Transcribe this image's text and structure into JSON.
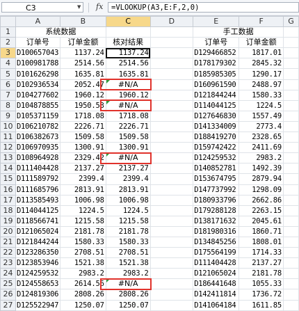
{
  "formula_bar": {
    "name_box": "C3",
    "fx_label": "fx",
    "formula": "=VLOOKUP(A3,E:F,2,0)"
  },
  "columns": [
    "A",
    "B",
    "C",
    "D",
    "E",
    "F",
    "G"
  ],
  "active_column": "C",
  "active_row": "3",
  "header_row1": {
    "left_title": "系统数据",
    "right_title": "手工数据"
  },
  "header_row2": {
    "a": "订单号",
    "b": "订单金额",
    "c": "核对结果",
    "e": "订单号",
    "f": "订单金额"
  },
  "rows": [
    {
      "n": "3",
      "a": "D100657043",
      "b": "1137.24",
      "c": "1137.24",
      "e": "D129466852",
      "f": "1817.01"
    },
    {
      "n": "4",
      "a": "D100981788",
      "b": "2514.56",
      "c": "2514.56",
      "e": "D178179302",
      "f": "2845.32"
    },
    {
      "n": "5",
      "a": "D101626298",
      "b": "1635.81",
      "c": "1635.81",
      "e": "D185985305",
      "f": "1290.17"
    },
    {
      "n": "6",
      "a": "D102936534",
      "b": "2052.47",
      "c": "#N/A",
      "e": "D160961590",
      "f": "2488.97"
    },
    {
      "n": "7",
      "a": "D104277602",
      "b": "1960.12",
      "c": "1960.12",
      "e": "D121844244",
      "f": "1580.33"
    },
    {
      "n": "8",
      "a": "D104878855",
      "b": "1950.53",
      "c": "#N/A",
      "e": "D114044125",
      "f": "1224.5"
    },
    {
      "n": "9",
      "a": "D105371159",
      "b": "1718.08",
      "c": "1718.08",
      "e": "D127646830",
      "f": "1557.49"
    },
    {
      "n": "10",
      "a": "D106210782",
      "b": "2226.71",
      "c": "2226.71",
      "e": "D141334009",
      "f": "2773.4"
    },
    {
      "n": "11",
      "a": "D106382673",
      "b": "1509.58",
      "c": "1509.58",
      "e": "D188419270",
      "f": "2328.65"
    },
    {
      "n": "12",
      "a": "D106970935",
      "b": "1300.91",
      "c": "1300.91",
      "e": "D159742422",
      "f": "2411.69"
    },
    {
      "n": "13",
      "a": "D108964928",
      "b": "2329.42",
      "c": "#N/A",
      "e": "D124259532",
      "f": "2983.2"
    },
    {
      "n": "14",
      "a": "D111404428",
      "b": "2137.27",
      "c": "2137.27",
      "e": "D140852781",
      "f": "1492.39"
    },
    {
      "n": "15",
      "a": "D111589792",
      "b": "2399.4",
      "c": "2399.4",
      "e": "D153674795",
      "f": "2879.94"
    },
    {
      "n": "16",
      "a": "D111685796",
      "b": "2813.91",
      "c": "2813.91",
      "e": "D147737992",
      "f": "1298.09"
    },
    {
      "n": "17",
      "a": "D113585493",
      "b": "1006.98",
      "c": "1006.98",
      "e": "D180933796",
      "f": "2662.86"
    },
    {
      "n": "18",
      "a": "D114044125",
      "b": "1224.5",
      "c": "1224.5",
      "e": "D179288128",
      "f": "2263.15"
    },
    {
      "n": "19",
      "a": "D118566741",
      "b": "1215.58",
      "c": "1215.58",
      "e": "D138171632",
      "f": "2045.61"
    },
    {
      "n": "20",
      "a": "D121065024",
      "b": "2181.78",
      "c": "2181.78",
      "e": "D181980316",
      "f": "1860.71"
    },
    {
      "n": "21",
      "a": "D121844244",
      "b": "1580.33",
      "c": "1580.33",
      "e": "D134845256",
      "f": "1808.01"
    },
    {
      "n": "22",
      "a": "D123286350",
      "b": "2708.51",
      "c": "2708.51",
      "e": "D175564199",
      "f": "1714.33"
    },
    {
      "n": "23",
      "a": "D123853946",
      "b": "1521.38",
      "c": "1521.38",
      "e": "D111404428",
      "f": "2137.27"
    },
    {
      "n": "24",
      "a": "D124259532",
      "b": "2983.2",
      "c": "2983.2",
      "e": "D121065024",
      "f": "2181.78"
    },
    {
      "n": "25",
      "a": "D124558653",
      "b": "2614.56",
      "c": "#N/A",
      "e": "D186441648",
      "f": "1055.33"
    },
    {
      "n": "26",
      "a": "D124819306",
      "b": "2808.26",
      "c": "2808.26",
      "e": "D142411814",
      "f": "1736.72"
    },
    {
      "n": "27",
      "a": "D125522947",
      "b": "1250.07",
      "c": "1250.07",
      "e": "D141064184",
      "f": "1611.85"
    }
  ],
  "error_rows": [
    "6",
    "8",
    "13",
    "25"
  ],
  "highlight_color": "#e0322b",
  "error_marker_color": "#2e9d3b"
}
